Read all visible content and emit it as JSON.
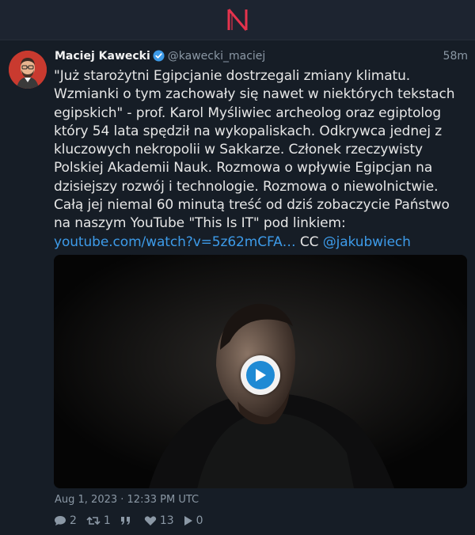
{
  "app": {
    "logo_letter": "N",
    "logo_color": "#e5334d"
  },
  "tweet": {
    "fullname": "Maciej Kawecki",
    "username": "@kawecki_maciej",
    "time": "58m",
    "text_main": "\"Już starożytni Egipcjanie dostrzegali zmiany klimatu. Wzmianki o tym zachowały się nawet w niektórych tekstach egipskich\" - prof. Karol Myśliwiec archeolog oraz egiptolog który 54 lata spędził na wykopaliskach. Odkrywca jednej z kluczowych nekropolii w Sakkarze. Członek rzeczywisty Polskiej Akademii Nauk. Rozmowa o wpływie Egipcjan na dzisiejszy rozwój i technologie. Rozmowa o niewolnictwie. Całą jej niemal 60 minutą treść od dziś zobaczycie Państwo na naszym YouTube \"This Is IT\" pod linkiem: ",
    "link_text": "youtube.com/watch?v=5z62mCFA…",
    "cc_text": " CC ",
    "mention": "@jakubwiech",
    "date": "Aug 1, 2023 · 12:33 PM UTC",
    "stats": {
      "replies": "2",
      "retweets": "1",
      "quotes": "",
      "likes": "13",
      "views": "0"
    },
    "media": {
      "type": "video",
      "play_icon": "play-icon"
    },
    "accent_color": "#3d9be9",
    "verified_icon": "verified-badge-icon"
  }
}
